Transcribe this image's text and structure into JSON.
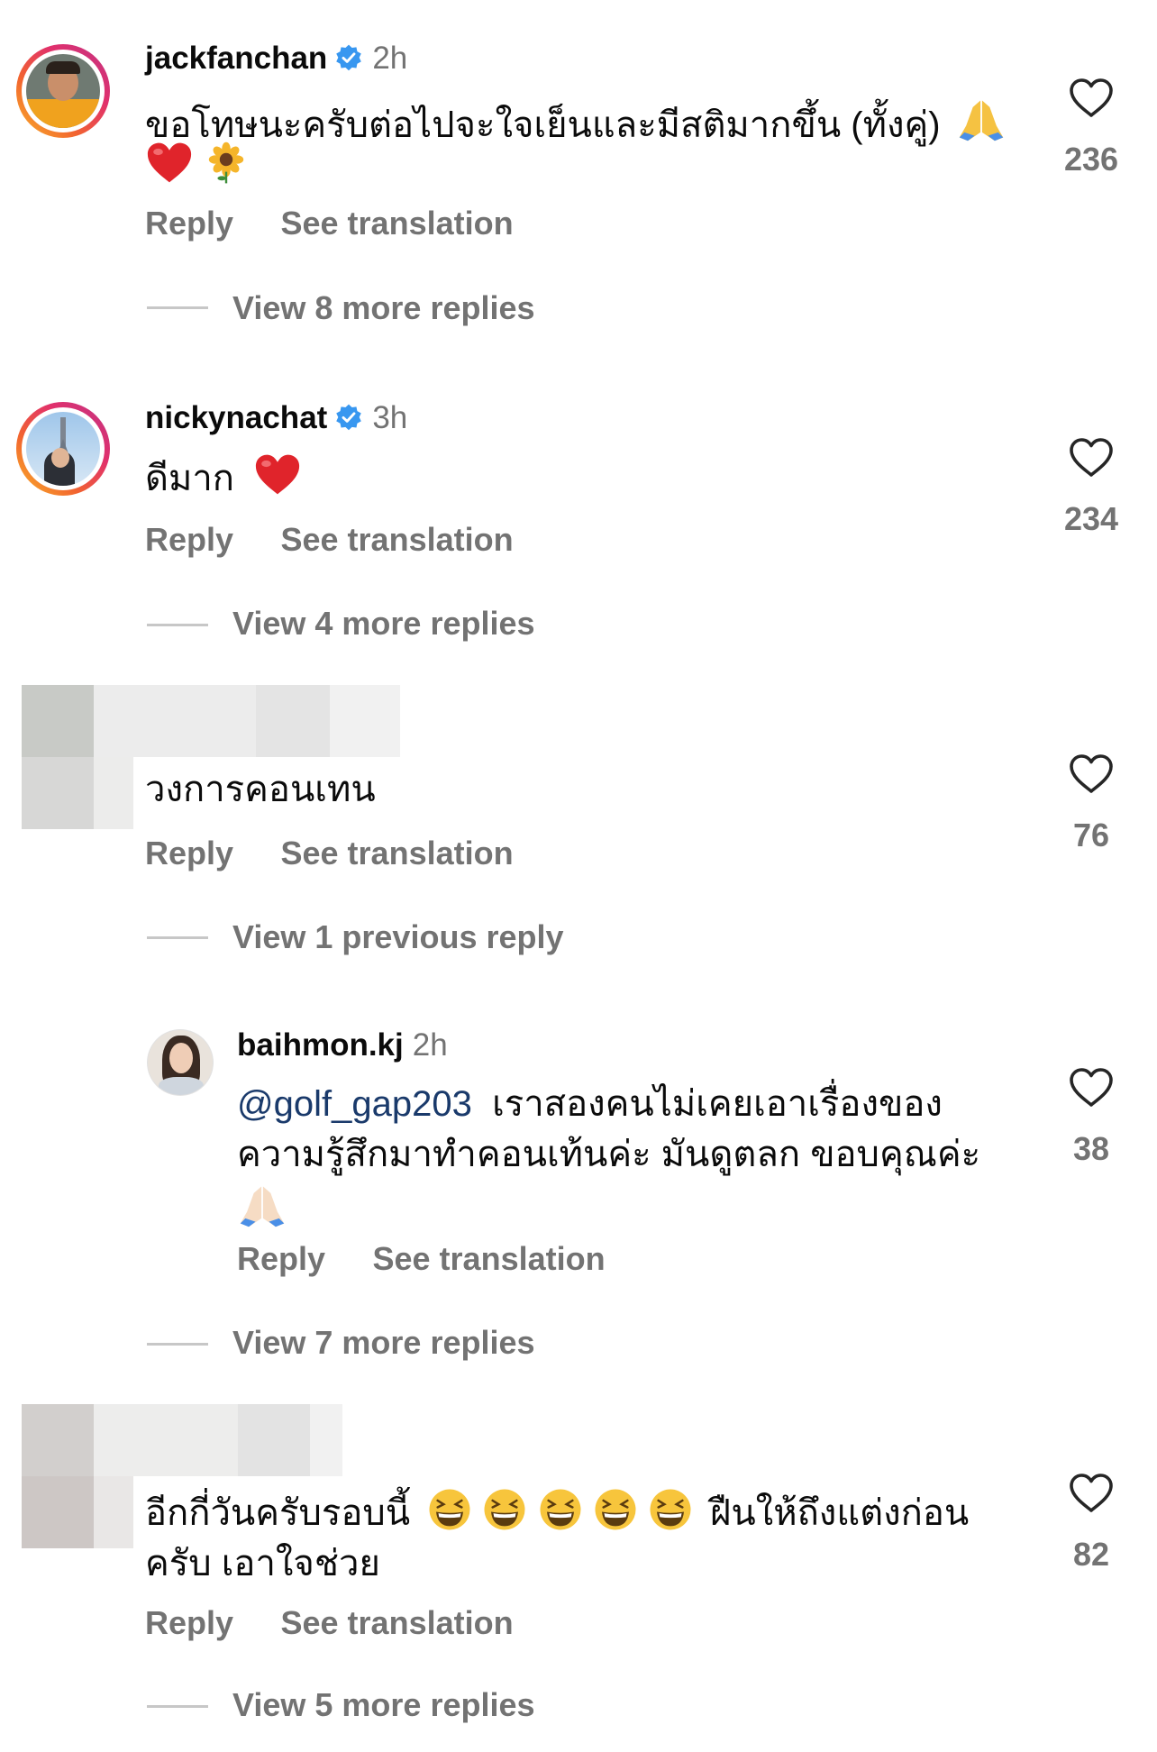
{
  "comments": [
    {
      "username": "jackfanchan",
      "time": "2h",
      "text": "ขอโทษนะครับต่อไปจะใจเย็นและมีสติมากขึ้น (ทั้งคู่)",
      "likes": "236",
      "reply_label": "Reply",
      "translate_label": "See translation",
      "more_replies": "View 8 more replies"
    },
    {
      "username": "nickynachat",
      "time": "3h",
      "text": "ดีมาก",
      "likes": "234",
      "reply_label": "Reply",
      "translate_label": "See translation",
      "more_replies": "View 4 more replies"
    },
    {
      "username": "",
      "time": "",
      "text": "วงการคอนเทน",
      "likes": "76",
      "reply_label": "Reply",
      "translate_label": "See translation",
      "more_replies": "View 1 previous reply"
    },
    {
      "username": "baihmon.kj",
      "time": "2h",
      "mention": "@golf_gap203",
      "text_line1": "เราสองคนไม่เคยเอาเรื่องของ",
      "text_line2": "ความรู้สึกมาทำคอนเท้นค่ะ มันดูตลก ขอบคุณค่ะ",
      "likes": "38",
      "reply_label": "Reply",
      "translate_label": "See translation",
      "more_replies": "View 7 more replies"
    },
    {
      "username": "",
      "time": "",
      "text_line1_a": "อีกกี่วันครับรอบนี้",
      "text_line1_b": "ฝืนให้ถึงแต่งก่อน",
      "text_line2": "ครับ เอาใจช่วย",
      "likes": "82",
      "reply_label": "Reply",
      "translate_label": "See translation",
      "more_replies": "View 5 more replies"
    }
  ],
  "colors": {
    "verified": "#3897f0",
    "secondary": "#737373",
    "mention": "#1a3a6b"
  },
  "icons": [
    "verified-badge-icon",
    "heart-icon",
    "folded-hands-emoji",
    "red-heart-emoji",
    "sunflower-emoji",
    "grinning-squinting-emoji"
  ]
}
